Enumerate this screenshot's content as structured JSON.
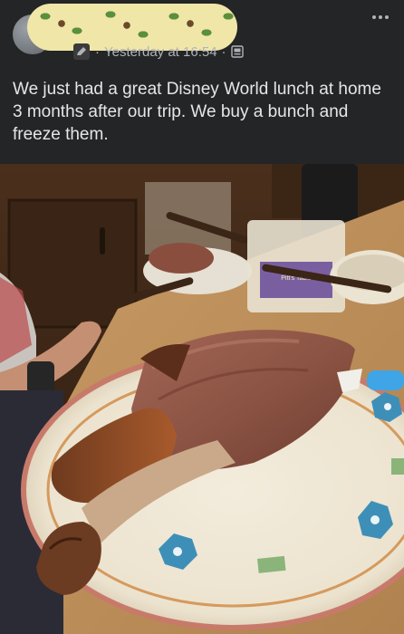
{
  "post": {
    "timestamp": "Yesterday at 16:54",
    "separator": "·",
    "text": "We just had a great Disney World lunch at home 3 months after our trip. We buy a bunch and freeze them.",
    "icons": {
      "edit": "pencil-edit-icon",
      "audience": "audience-icon",
      "more": "more-horizontal-icon"
    }
  },
  "photo": {
    "subject": "turkey-leg-on-plate",
    "package_label": "Pitt's Table"
  },
  "colors": {
    "background": "#242526",
    "primary_text": "#e4e6eb",
    "secondary_text": "#b0b3b8"
  }
}
